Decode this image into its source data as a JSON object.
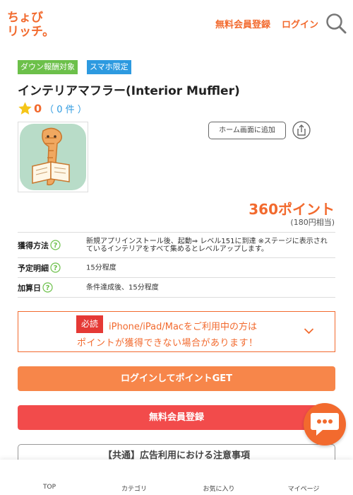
{
  "header": {
    "logo_text": "ちょびリッチ。",
    "register_label": "無料会員登録",
    "login_label": "ログイン"
  },
  "badges": {
    "down": "ダウン報酬対象",
    "smartphone": "スマホ限定"
  },
  "app": {
    "title": "インテリアマフラー(Interior Muffler)",
    "rating_score": "0",
    "rating_count": "（ 0 件 ）",
    "home_button": "ホーム画面に追加",
    "points": "360ポイント",
    "yen": "(180円相当)"
  },
  "info": {
    "method_label": "獲得方法",
    "method_value": "新規アプリインストール後、起動⇒ レベル151に到達 ※ステージに表示されているインテリアをすべて集めるとレベルアップします。",
    "schedule_label": "予定明細",
    "schedule_value": "15分程度",
    "date_label": "加算日",
    "date_value": "条件達成後、15分程度"
  },
  "notice": {
    "tag": "必読",
    "line1": "iPhone/iPad/Macをご利用中の方は",
    "line2": "ポイントが獲得できない場合があります！"
  },
  "buttons": {
    "login_get": "ログインしてポイントGET",
    "register": "無料会員登録"
  },
  "caution": {
    "title": "【共通】広告利用における注意事項"
  },
  "nav": {
    "top": "TOP",
    "category": "カテゴリ",
    "favorites": "お気に入り",
    "mypage": "マイページ"
  },
  "colors": {
    "accent": "#f26a2e",
    "register_red": "#f24b4b",
    "badge_green": "#6cc04a",
    "badge_blue": "#2d9ae0"
  }
}
